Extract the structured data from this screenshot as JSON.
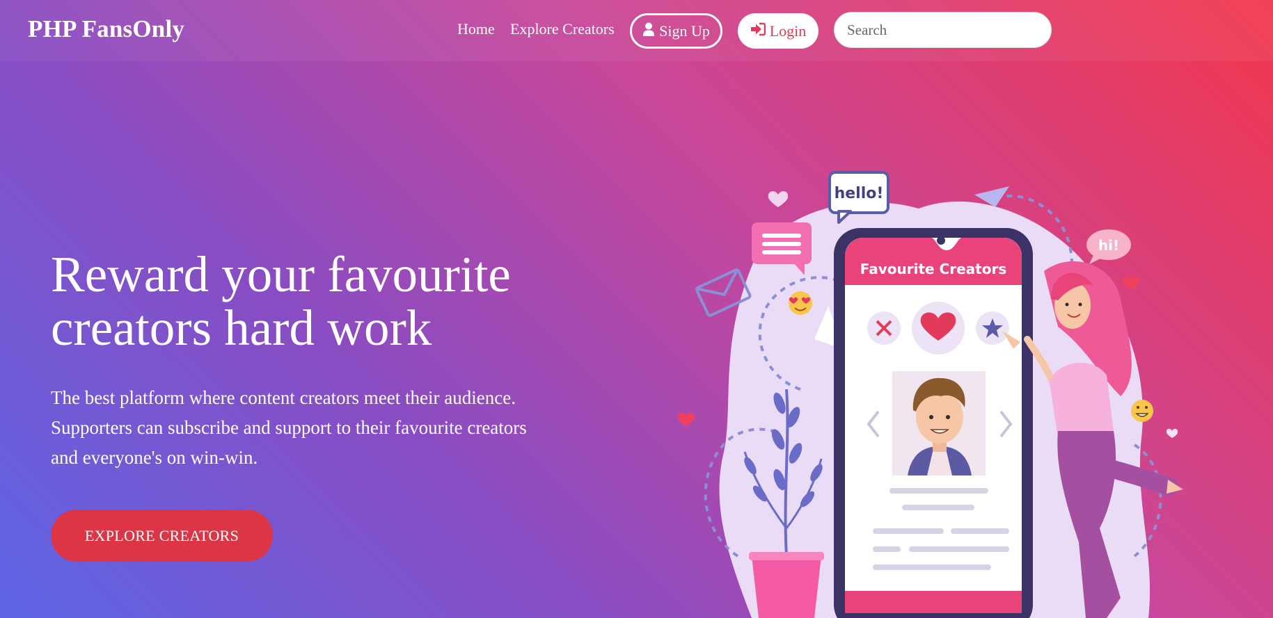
{
  "navbar": {
    "brand": "PHP FansOnly",
    "links": [
      {
        "label": "Home"
      },
      {
        "label": "Explore Creators"
      }
    ],
    "signup_label": "Sign Up",
    "login_label": "Login",
    "search_placeholder": "Search"
  },
  "hero": {
    "title_line1": "Reward your favourite",
    "title_line2": "creators hard work",
    "subtitle_line1": "The best platform where content creators meet their audience.",
    "subtitle_line2": "Supporters can subscribe and support to their favourite creators",
    "subtitle_line3": "and everyone's on win-win.",
    "cta_label": "EXPLORE CREATORS"
  },
  "illustration": {
    "phone_header": "Favourite Creators",
    "bubble_hello": "hello!",
    "bubble_hi": "hi!"
  },
  "icons": {
    "signup": "user-icon",
    "login": "sign-in-icon"
  },
  "colors": {
    "accent_red": "#dc3545",
    "login_text": "#e23a5a",
    "phone_pink": "#e8447a"
  }
}
